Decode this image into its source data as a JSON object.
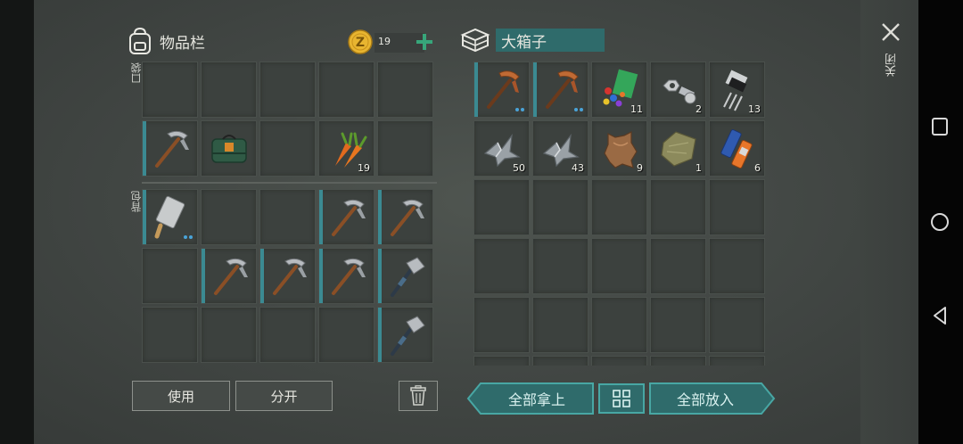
{
  "inventory": {
    "title": "物品栏",
    "coin_count": "19",
    "pocket_label": "口袋",
    "backpack_label": "背包",
    "pocket_slots": [
      {
        "icon": "",
        "qty": "",
        "bar": false
      },
      {
        "icon": "",
        "qty": "",
        "bar": false
      },
      {
        "icon": "",
        "qty": "",
        "bar": false
      },
      {
        "icon": "",
        "qty": "",
        "bar": false
      },
      {
        "icon": "",
        "qty": "",
        "bar": false
      },
      {
        "icon": "pickaxe-icon",
        "qty": "",
        "bar": true
      },
      {
        "icon": "first-aid-kit-icon",
        "qty": "",
        "bar": false
      },
      {
        "icon": "",
        "qty": "",
        "bar": false
      },
      {
        "icon": "carrot-icon",
        "qty": "19",
        "bar": false
      },
      {
        "icon": "",
        "qty": "",
        "bar": false
      }
    ],
    "backpack_slots": [
      {
        "icon": "cleaver-icon",
        "qty": "",
        "bar": true,
        "dots": true
      },
      {
        "icon": "",
        "qty": "",
        "bar": false
      },
      {
        "icon": "",
        "qty": "",
        "bar": false
      },
      {
        "icon": "pickaxe-icon",
        "qty": "",
        "bar": true
      },
      {
        "icon": "pickaxe-icon",
        "qty": "",
        "bar": true
      },
      {
        "icon": "",
        "qty": "",
        "bar": false
      },
      {
        "icon": "pickaxe-icon",
        "qty": "",
        "bar": true
      },
      {
        "icon": "pickaxe-icon",
        "qty": "",
        "bar": true
      },
      {
        "icon": "pickaxe-icon",
        "qty": "",
        "bar": true
      },
      {
        "icon": "hatchet-icon",
        "qty": "",
        "bar": true
      },
      {
        "icon": "",
        "qty": "",
        "bar": false
      },
      {
        "icon": "",
        "qty": "",
        "bar": false
      },
      {
        "icon": "",
        "qty": "",
        "bar": false
      },
      {
        "icon": "",
        "qty": "",
        "bar": false
      },
      {
        "icon": "hatchet-icon",
        "qty": "",
        "bar": true
      }
    ],
    "use_label": "使用",
    "split_label": "分开"
  },
  "chest": {
    "title": "大箱子",
    "slots": [
      {
        "icon": "copper-pickaxe-icon",
        "qty": "",
        "bar": true,
        "dots": true
      },
      {
        "icon": "copper-pickaxe-icon",
        "qty": "",
        "bar": true,
        "dots": true
      },
      {
        "icon": "plastic-parts-icon",
        "qty": "11"
      },
      {
        "icon": "nuts-bolts-icon",
        "qty": "2"
      },
      {
        "icon": "transistor-icon",
        "qty": "13"
      },
      {
        "icon": "scrap-metal-icon",
        "qty": "50"
      },
      {
        "icon": "scrap-metal-icon",
        "qty": "43"
      },
      {
        "icon": "leather-hide-icon",
        "qty": "9"
      },
      {
        "icon": "cloth-icon",
        "qty": "1"
      },
      {
        "icon": "battery-icon",
        "qty": "6"
      }
    ],
    "take_all_label": "全部拿上",
    "put_all_label": "全部放入"
  },
  "close_label": "关闭",
  "colors": {
    "accent_teal": "#3b8a92",
    "coin_gold": "#e8b530",
    "plus_green": "#37a67a"
  }
}
